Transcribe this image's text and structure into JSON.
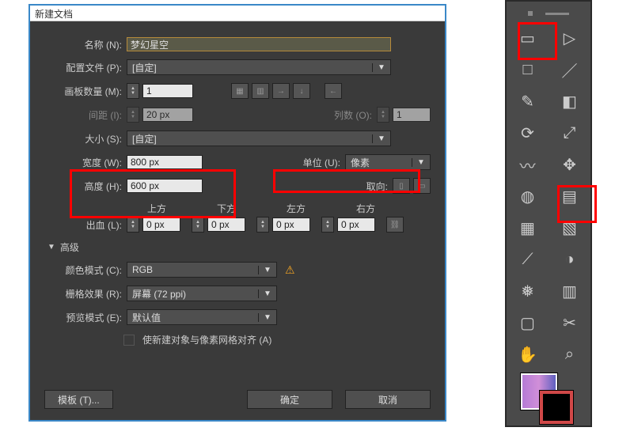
{
  "dialog": {
    "title": "新建文档",
    "name_label": "名称 (N):",
    "name_value": "梦幻星空",
    "profile_label": "配置文件 (P):",
    "profile_value": "[自定]",
    "artboards_label": "画板数量 (M):",
    "artboards_value": "1",
    "spacing_label": "间距 (I):",
    "spacing_value": "20 px",
    "columns_label": "列数 (O):",
    "columns_value": "1",
    "size_label": "大小 (S):",
    "size_value": "[自定]",
    "width_label": "宽度 (W):",
    "width_value": "800 px",
    "height_label": "高度 (H):",
    "height_value": "600 px",
    "units_label": "单位 (U):",
    "units_value": "像素",
    "orient_label": "取向:",
    "bleed_label": "出血 (L):",
    "bleed_top": "上方",
    "bleed_bottom": "下方",
    "bleed_left": "左方",
    "bleed_right": "右方",
    "bleed_val": "0 px",
    "advanced": "高级",
    "colormode_label": "颜色模式 (C):",
    "colormode_value": "RGB",
    "raster_label": "栅格效果 (R):",
    "raster_value": "屏幕 (72 ppi)",
    "preview_label": "预览模式 (E):",
    "preview_value": "默认值",
    "align_label": "使新建对象与像素网格对齐 (A)",
    "templates_btn": "模板 (T)...",
    "ok_btn": "确定",
    "cancel_btn": "取消"
  },
  "tools": [
    "selection",
    "direct-selection",
    "rectangle",
    "brush",
    "pencil",
    "eraser",
    "rotate",
    "scale",
    "width",
    "free-transform",
    "shape-builder",
    "perspective-grid",
    "mesh",
    "gradient",
    "eyedropper",
    "blend",
    "symbol-sprayer",
    "column-graph",
    "artboard",
    "slice",
    "hand",
    "zoom"
  ]
}
